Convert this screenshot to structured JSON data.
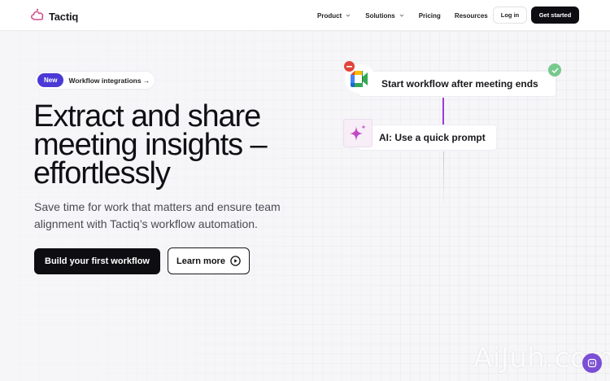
{
  "header": {
    "logo_text": "Tactiq",
    "nav": [
      {
        "label": "Product",
        "has_dropdown": true
      },
      {
        "label": "Solutions",
        "has_dropdown": true
      },
      {
        "label": "Pricing",
        "has_dropdown": false
      },
      {
        "label": "Resources",
        "has_dropdown": true
      }
    ],
    "login_label": "Log in",
    "get_started_label": "Get started"
  },
  "hero": {
    "badge_new": "New",
    "badge_text": "Workflow integrations →",
    "headline": "Extract and share meeting insights – effortlessly",
    "subtext": "Save time for work that matters and ensure team alignment with Tactiq’s workflow automation.",
    "primary_button": "Build your first workflow",
    "secondary_button": "Learn more"
  },
  "workflow": {
    "step1": "Start workflow after meeting ends",
    "step2": "AI: Use a quick prompt"
  },
  "watermark": "AiJuh.com",
  "colors": {
    "accent": "#4b39d6",
    "dark": "#0e0e12",
    "workflow_line": "#9c3bd6",
    "check": "#77c98d",
    "minus": "#e0453a"
  }
}
